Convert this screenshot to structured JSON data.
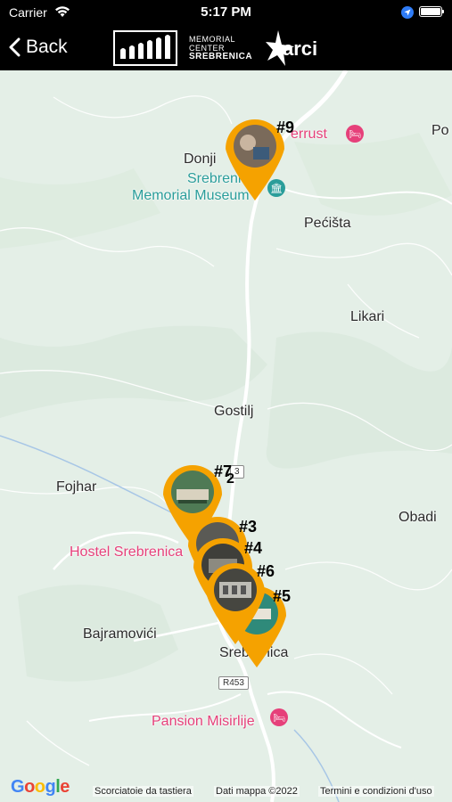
{
  "status_bar": {
    "carrier": "Carrier",
    "time": "5:17 PM"
  },
  "nav": {
    "back_label": "Back",
    "memorial_line1": "MEMORIAL",
    "memorial_line2": "CENTER",
    "memorial_line3": "SREBRENICA",
    "arci_label": "arci"
  },
  "map": {
    "places": {
      "donji": "Donji",
      "srebrenica_top": "Srebrenica",
      "memorial_museum": "Memorial Museum",
      "pecista": "Pećišta",
      "likari": "Likari",
      "gostilj": "Gostilj",
      "fojhar": "Fojhar",
      "obadi": "Obadi",
      "bajramovici": "Bajramovići",
      "srebrenica": "Srebrenica",
      "po": "Po",
      "cut_badge": "3"
    },
    "pois": {
      "hostel": "Hostel Srebrenica",
      "pansion": "Pansion Misirlije",
      "errust": "errust"
    },
    "road": "R453",
    "markers": [
      "#9",
      "#7",
      "#3",
      "#4",
      "#6",
      "#5",
      "2"
    ]
  },
  "footer": {
    "google": "Google",
    "shortcuts": "Scorciatoie da tastiera",
    "map_data": "Dati mappa ©2022",
    "terms": "Termini e condizioni d'uso"
  },
  "colors": {
    "marker": "#f5a200",
    "poi": "#e6407a",
    "museum": "#2a9d9a"
  }
}
